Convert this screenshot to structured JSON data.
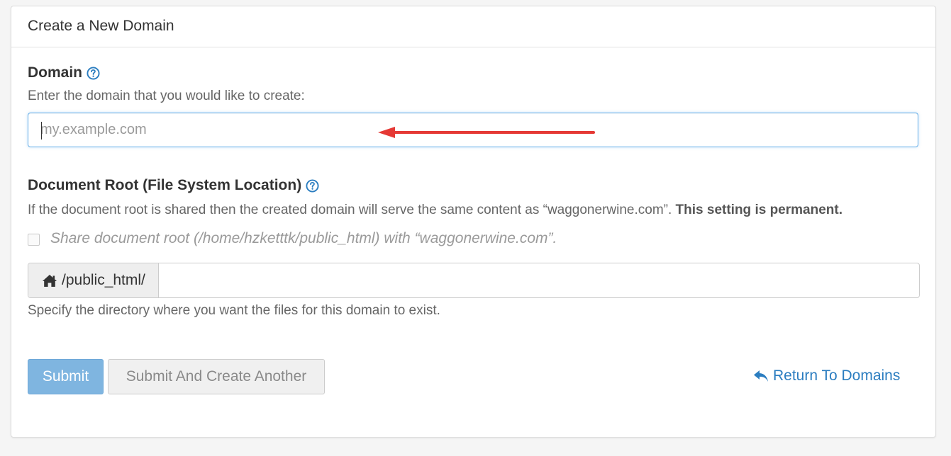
{
  "panel": {
    "title": "Create a New Domain"
  },
  "domain": {
    "label": "Domain",
    "help_icon": "question-circle-icon",
    "instructions": "Enter the domain that you would like to create:",
    "input_value": "",
    "input_placeholder": "my.example.com"
  },
  "document_root": {
    "label": "Document Root (File System Location)",
    "help_icon": "question-circle-icon",
    "description": "If the document root is shared then the created domain will serve the same content as “waggonerwine.com”.",
    "description_bold": "This setting is permanent.",
    "share_checkbox_checked": false,
    "share_label": "Share document root (/home/hzketttk/public_html) with “waggonerwine.com”.",
    "prefix_icon": "home-icon",
    "prefix": "/public_html/",
    "input_value": "",
    "hint": "Specify the directory where you want the files for this domain to exist."
  },
  "actions": {
    "submit_label": "Submit",
    "submit_another_label": "Submit And Create Another",
    "return_icon": "reply-arrow-icon",
    "return_label": "Return To Domains"
  },
  "annotation": {
    "arrow_color": "#e53935"
  },
  "colors": {
    "link": "#2b7dc0",
    "submit_bg": "#7fb5e0",
    "focus_border": "#66afe9"
  }
}
